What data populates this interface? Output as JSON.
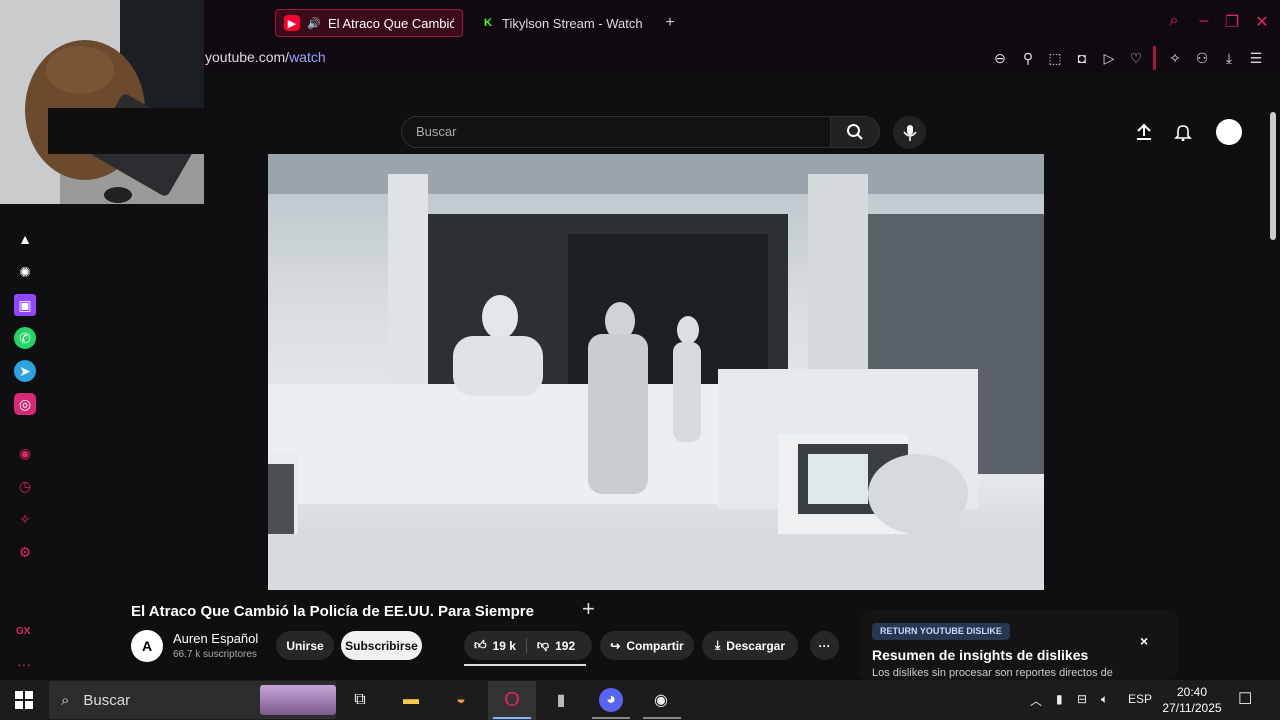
{
  "browser": {
    "tabs": [
      {
        "label": "El Atraco Que Cambió la Policía de EE.UU.",
        "active": true,
        "icon": "youtube-icon"
      },
      {
        "label": "Tikylson Stream - Watch Live",
        "active": false,
        "icon": "kick-icon"
      }
    ],
    "new_tab_symbol": "+",
    "url_host": "youtube.com/",
    "url_path": "watch",
    "accent": "#e0245e"
  },
  "sidebar": {
    "badge": "GX",
    "more": "···"
  },
  "youtube": {
    "search_placeholder": "Buscar",
    "video": {
      "title": "El Atraco Que Cambió la Policía de EE.UU. Para Siempre",
      "channel_name": "Auren Español",
      "channel_avatar_text": "A",
      "subscribers": "66.7 k suscriptores",
      "join_label": "Unirse",
      "subscribe_label": "Subscribirse",
      "likes": "19 k",
      "dislikes": "192",
      "share_label": "Compartir",
      "download_label": "Descargar",
      "more_label": "···"
    },
    "dislike_panel": {
      "badge": "RETURN YOUTUBE DISLIKE",
      "title": "Resumen de insights de dislikes",
      "text": "Los dislikes sin procesar son reportes directos de",
      "close": "×"
    }
  },
  "taskbar": {
    "search_label": "Buscar",
    "language": "ESP",
    "time": "20:40",
    "date": "27/11/2025"
  }
}
